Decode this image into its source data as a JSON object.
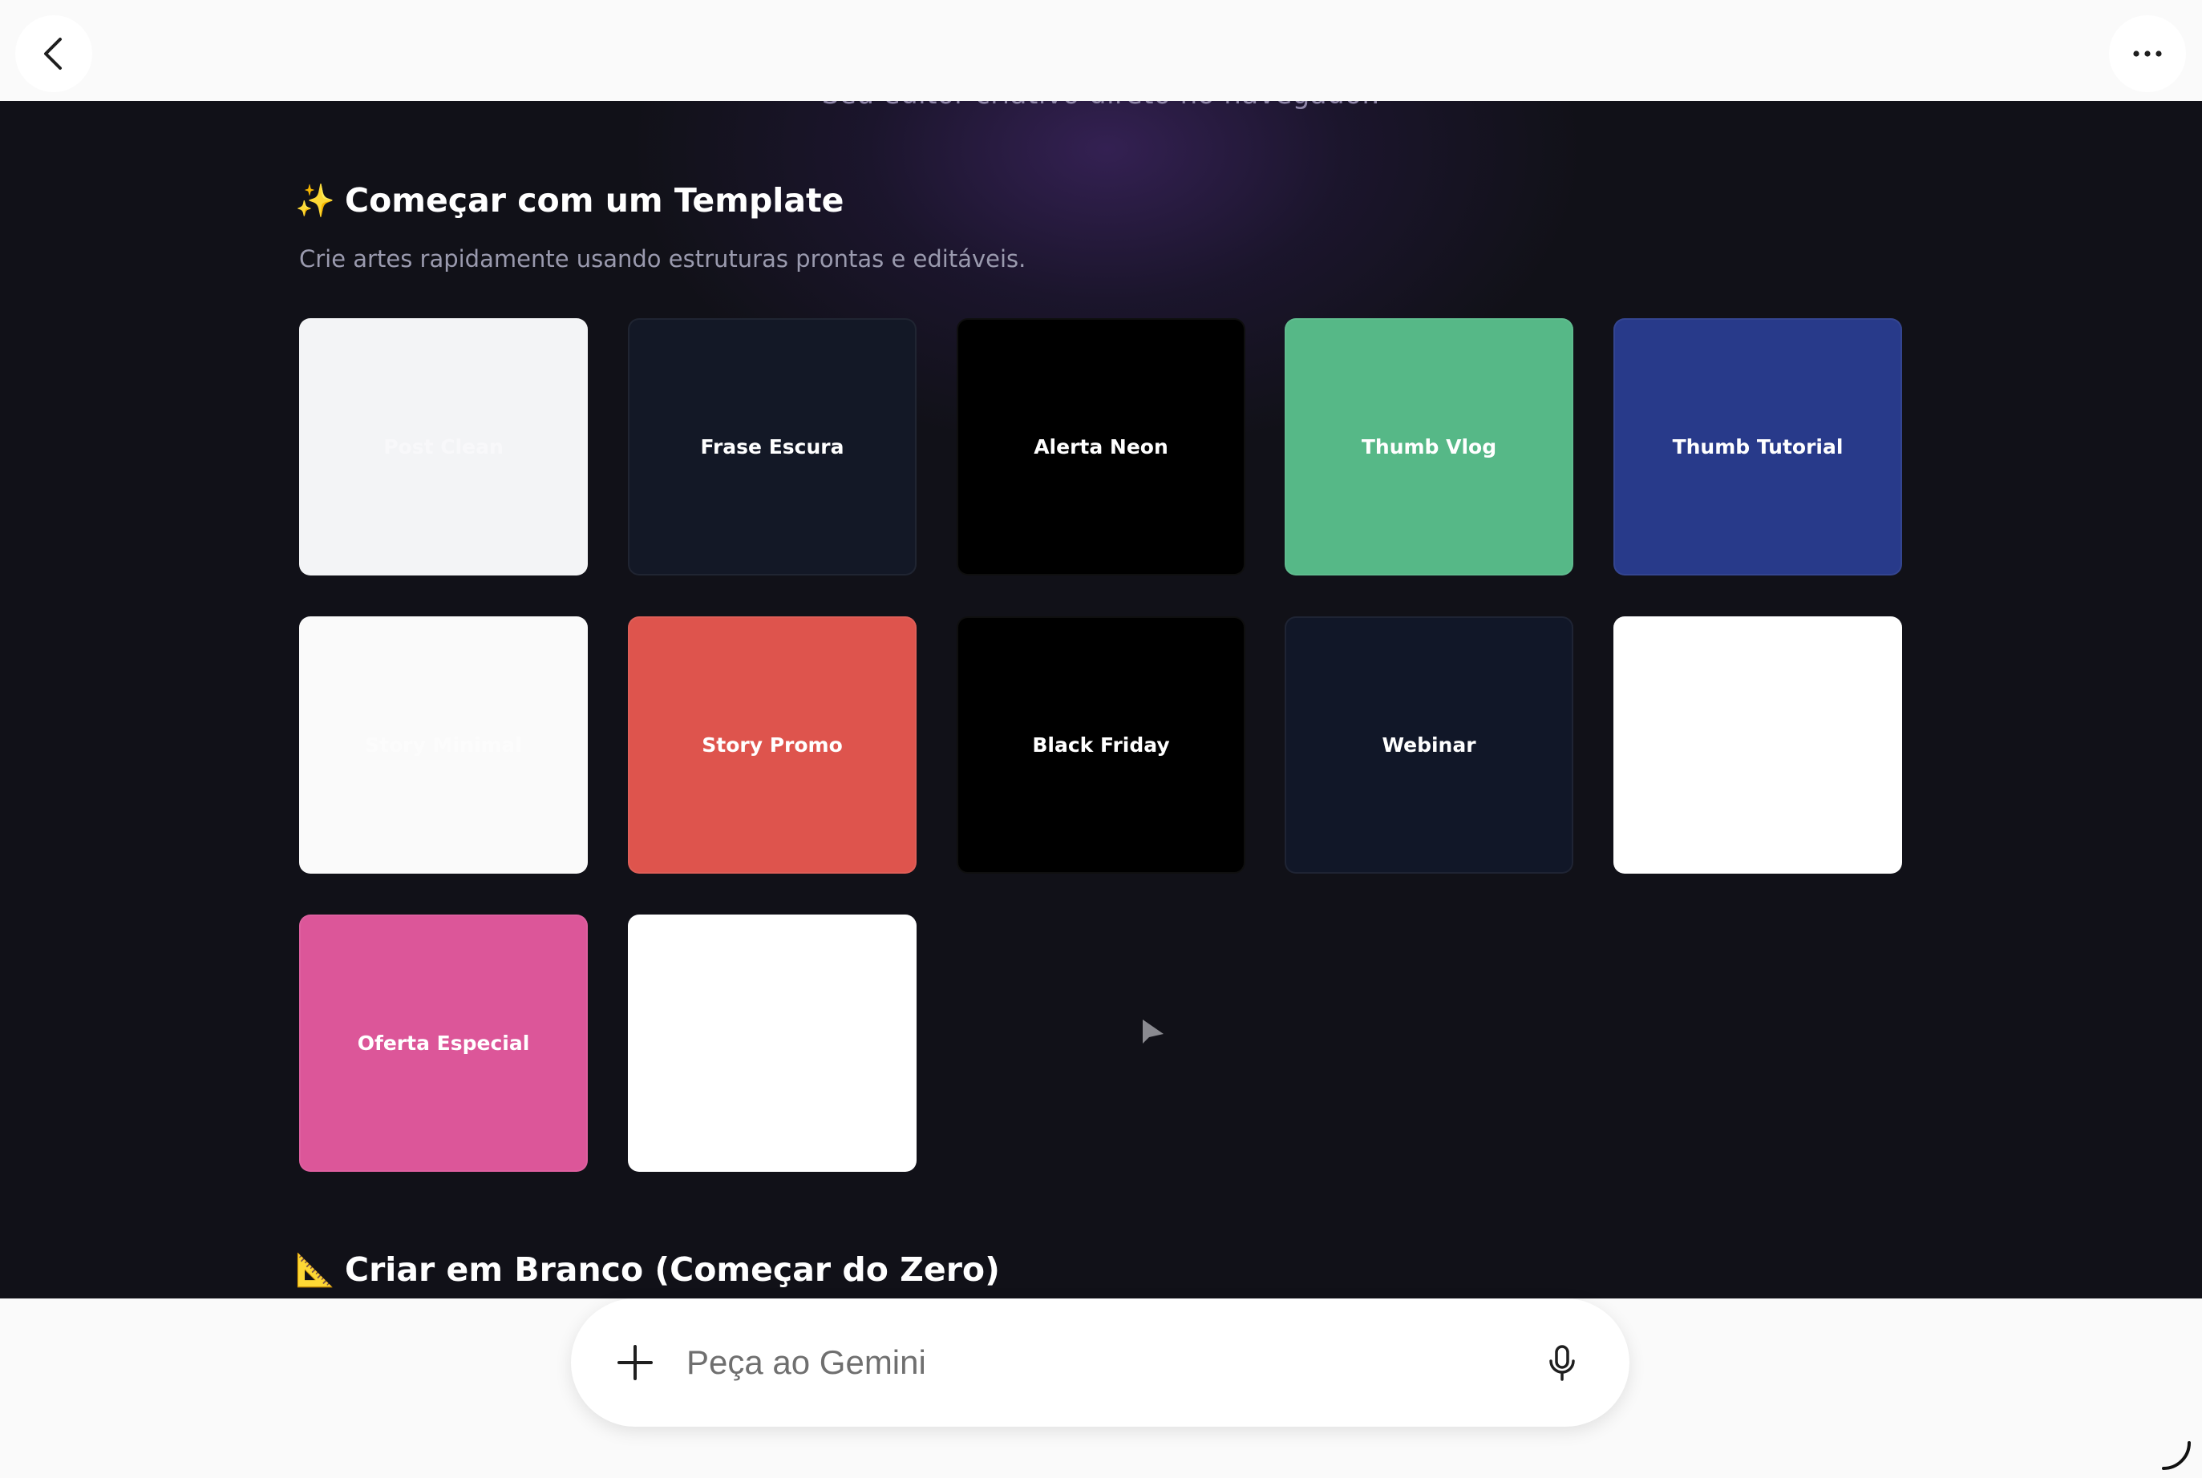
{
  "header": {
    "back_icon": "chevron-left-icon",
    "more_icon": "more-horizontal-icon"
  },
  "hero": {
    "tagline": "Seu editor criativo direto no navegador."
  },
  "templates_section": {
    "emoji": "✨",
    "title": "Começar com um Template",
    "subtitle": "Crie artes rapidamente usando estruturas prontas e editáveis.",
    "cards": [
      {
        "label": "Post Clean",
        "bg": "#f3f4f6",
        "fg": "#f8f8fa"
      },
      {
        "label": "Frase Escura",
        "bg": "#131826",
        "fg": "#ffffff"
      },
      {
        "label": "Alerta Neon",
        "bg": "#000000",
        "fg": "#ffffff"
      },
      {
        "label": "Thumb Vlog",
        "bg": "#56b887",
        "fg": "#ffffff"
      },
      {
        "label": "Thumb Tutorial",
        "bg": "#283a8a",
        "fg": "#ffffff"
      },
      {
        "label": "Story Minimal",
        "bg": "#fafafa",
        "fg": "#fcfcfc"
      },
      {
        "label": "Story Promo",
        "bg": "#de544d",
        "fg": "#ffffff"
      },
      {
        "label": "Black Friday",
        "bg": "#000000",
        "fg": "#ffffff"
      },
      {
        "label": "Webinar",
        "bg": "#111728",
        "fg": "#ffffff"
      },
      {
        "label": "",
        "bg": "#ffffff",
        "fg": "#ffffff"
      },
      {
        "label": "Oferta Especial",
        "bg": "#dc5699",
        "fg": "#ffffff"
      },
      {
        "label": "",
        "bg": "#ffffff",
        "fg": "#ffffff"
      }
    ]
  },
  "blank_section": {
    "emoji": "📐",
    "title": "Criar em Branco (Começar do Zero)"
  },
  "prompt_bar": {
    "placeholder": "Peça ao Gemini",
    "plus_icon": "plus-icon",
    "mic_icon": "microphone-icon"
  }
}
